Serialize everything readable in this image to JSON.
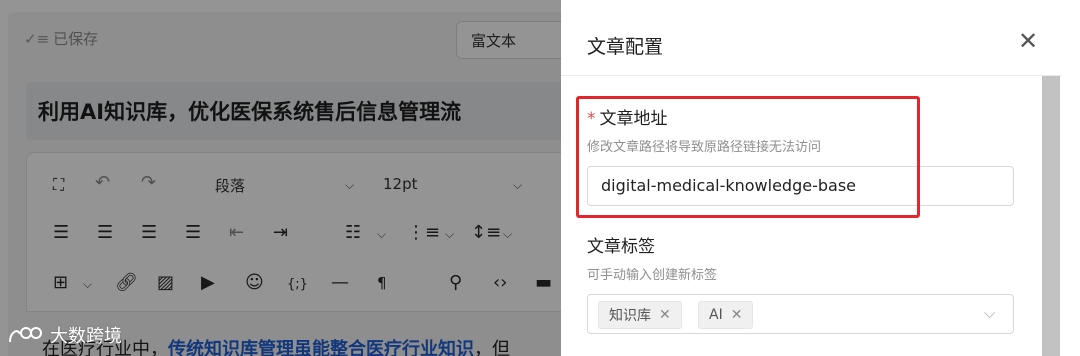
{
  "editor": {
    "saved_status": "已保存",
    "mode_select": "富文本",
    "title": "利用AI知识库，优化医保系统售后信息管理流",
    "toolbar": {
      "paragraph_select": "段落",
      "font_size_select": "12pt"
    },
    "body": {
      "prefix": "在医疗行业中，",
      "link": "传统知识库管理虽能整合医疗行业知识",
      "suffix": "，但"
    }
  },
  "watermark": {
    "text": "大数跨境"
  },
  "drawer": {
    "title": "文章配置",
    "close_icon": "close-icon",
    "url_field": {
      "required_mark": "*",
      "label": "文章地址",
      "hint": "修改文章路径将导致原路径链接无法访问",
      "value": "digital-medical-knowledge-base"
    },
    "tags_field": {
      "label": "文章标签",
      "hint": "可手动输入创建新标签",
      "tags": [
        {
          "label": "知识库"
        },
        {
          "label": "AI"
        }
      ]
    }
  },
  "colors": {
    "link": "#1f5fd6",
    "required": "#e34d4d",
    "highlight": "#e3262a",
    "overlay": "rgba(0,0,0,0.42)"
  }
}
